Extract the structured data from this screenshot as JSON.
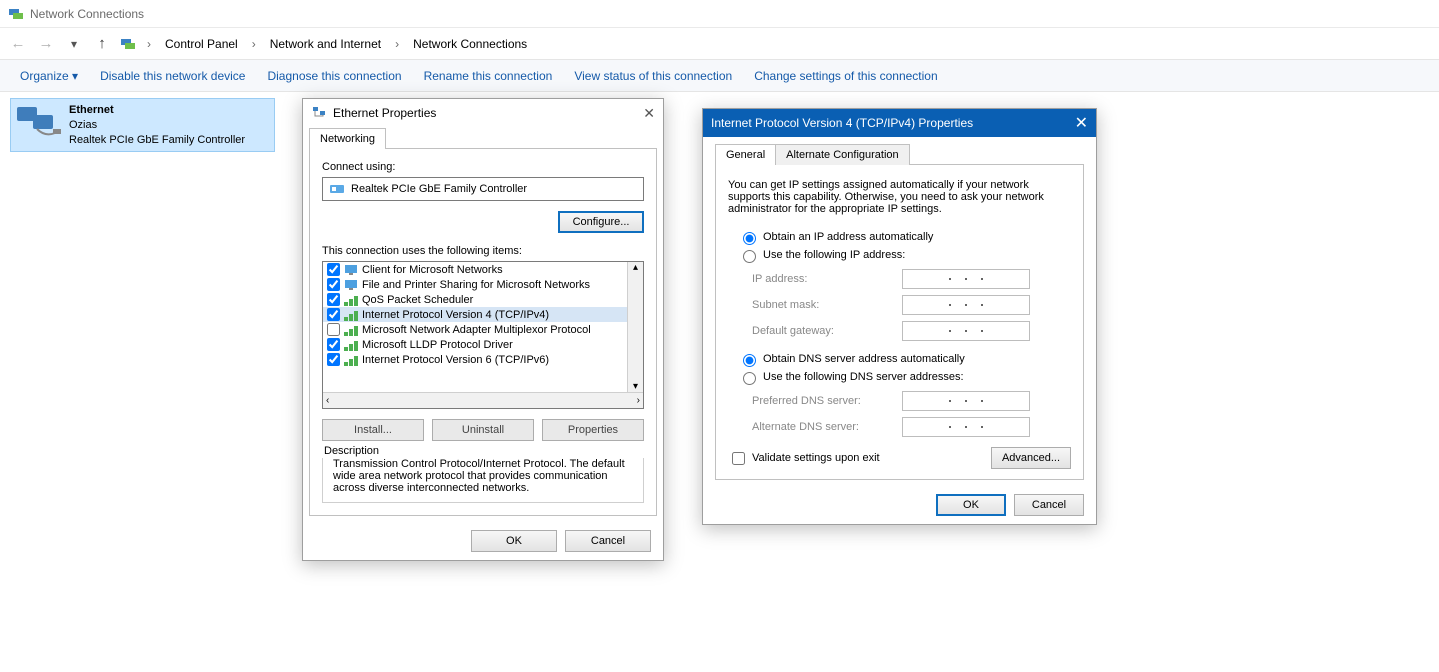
{
  "window": {
    "title": "Network Connections"
  },
  "breadcrumb": {
    "cp": "Control Panel",
    "ni": "Network and Internet",
    "nc": "Network Connections"
  },
  "toolbar": {
    "organize": "Organize  ▾",
    "disable": "Disable this network device",
    "diagnose": "Diagnose this connection",
    "rename": "Rename this connection",
    "view": "View status of this connection",
    "change": "Change settings of this connection"
  },
  "connection": {
    "name": "Ethernet",
    "network": "Ozias",
    "adapter": "Realtek PCIe GbE Family Controller"
  },
  "eth_dlg": {
    "title": "Ethernet Properties",
    "tab": "Networking",
    "connect_using": "Connect using:",
    "adapter": "Realtek PCIe GbE Family Controller",
    "configure": "Configure...",
    "uses_items": "This connection uses the following items:",
    "items": [
      {
        "checked": true,
        "label": "Client for Microsoft Networks",
        "sel": false,
        "icon": "mon"
      },
      {
        "checked": true,
        "label": "File and Printer Sharing for Microsoft Networks",
        "sel": false,
        "icon": "mon"
      },
      {
        "checked": true,
        "label": "QoS Packet Scheduler",
        "sel": false,
        "icon": "net"
      },
      {
        "checked": true,
        "label": "Internet Protocol Version 4 (TCP/IPv4)",
        "sel": true,
        "icon": "net"
      },
      {
        "checked": false,
        "label": "Microsoft Network Adapter Multiplexor Protocol",
        "sel": false,
        "icon": "net"
      },
      {
        "checked": true,
        "label": "Microsoft LLDP Protocol Driver",
        "sel": false,
        "icon": "net"
      },
      {
        "checked": true,
        "label": "Internet Protocol Version 6 (TCP/IPv6)",
        "sel": false,
        "icon": "net"
      }
    ],
    "install": "Install...",
    "uninstall": "Uninstall",
    "properties": "Properties",
    "desc_hdr": "Description",
    "desc": "Transmission Control Protocol/Internet Protocol. The default wide area network protocol that provides communication across diverse interconnected networks.",
    "ok": "OK",
    "cancel": "Cancel"
  },
  "ip_dlg": {
    "title": "Internet Protocol Version 4 (TCP/IPv4) Properties",
    "tab_general": "General",
    "tab_alt": "Alternate Configuration",
    "intro": "You can get IP settings assigned automatically if your network supports this capability. Otherwise, you need to ask your network administrator for the appropriate IP settings.",
    "r_obtain_ip": "Obtain an IP address automatically",
    "r_use_ip": "Use the following IP address:",
    "ip_address": "IP address:",
    "subnet": "Subnet mask:",
    "gateway": "Default gateway:",
    "r_obtain_dns": "Obtain DNS server address automatically",
    "r_use_dns": "Use the following DNS server addresses:",
    "pref_dns": "Preferred DNS server:",
    "alt_dns": "Alternate DNS server:",
    "validate": "Validate settings upon exit",
    "advanced": "Advanced...",
    "ok": "OK",
    "cancel": "Cancel"
  }
}
